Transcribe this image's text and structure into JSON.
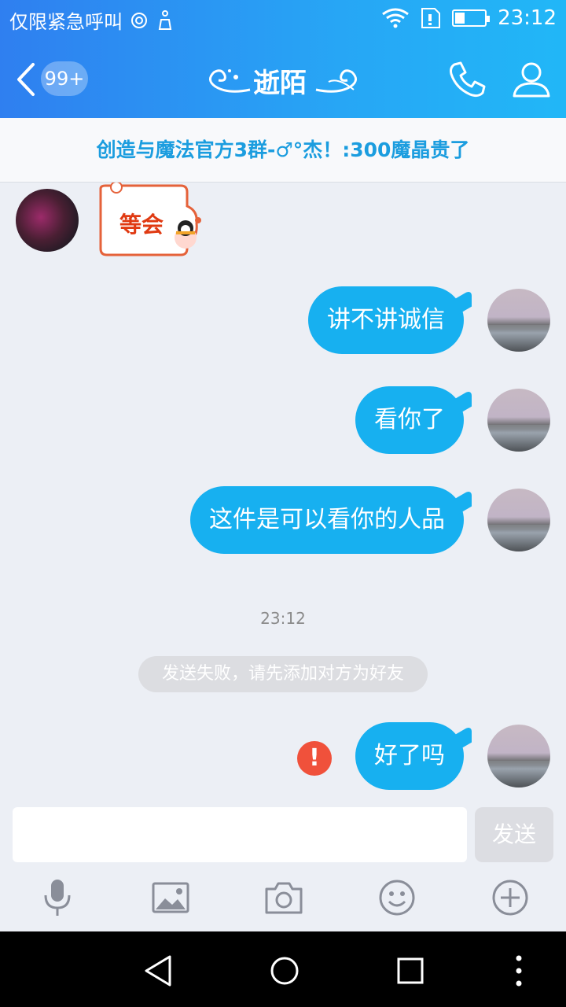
{
  "status_bar": {
    "carrier_text": "仅限紧急呼叫",
    "time": "23:12"
  },
  "header": {
    "back_badge": "99+",
    "title": "逝陌"
  },
  "notice": {
    "text": "创造与魔法官方3群-♂°杰！:300魔晶贵了"
  },
  "messages": [
    {
      "sender": "peer",
      "type": "sticker",
      "text": "等会"
    },
    {
      "sender": "me",
      "type": "text",
      "text": "讲不讲诚信"
    },
    {
      "sender": "me",
      "type": "text",
      "text": "看你了"
    },
    {
      "sender": "me",
      "type": "text",
      "text": "这件是可以看你的人品"
    },
    {
      "sender": "me",
      "type": "text",
      "text": "好了吗",
      "failed": true
    }
  ],
  "timestamp": "23:12",
  "system_message": "发送失败，请先添加对方为好友",
  "composer": {
    "value": "",
    "send_label": "发送"
  },
  "toolbar_icons": [
    "microphone-icon",
    "image-icon",
    "camera-icon",
    "emoji-icon",
    "plus-icon"
  ],
  "colors": {
    "header_start": "#2f7ff0",
    "header_end": "#21b7f7",
    "bubble": "#17b0f0",
    "notice_text": "#1b9ddf",
    "fail_badge": "#f0513b",
    "background": "#eceff5"
  }
}
